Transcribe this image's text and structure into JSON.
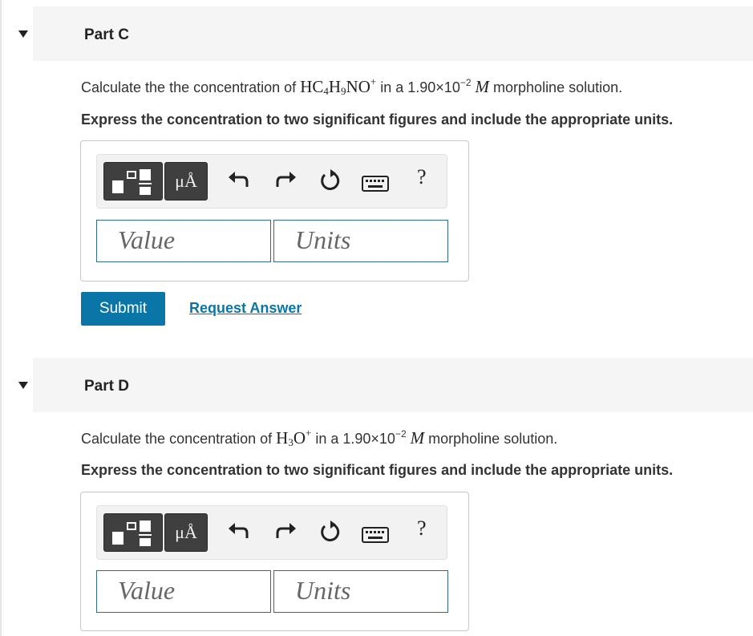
{
  "parts": [
    {
      "title": "Part C",
      "question": {
        "pre": "Calculate the the concentration of ",
        "species_html_parts": {
          "a": "HC",
          "b": "4",
          "c": "H",
          "d": "9",
          "e": "NO",
          "f": "+"
        },
        "mid": " in a 1.90×10",
        "exp": "−2",
        "m": "M",
        "post": " morpholine solution."
      },
      "instruction": "Express the concentration to two significant figures and include the appropriate units.",
      "toolbar": {
        "units_label": "μÅ",
        "help_label": "?"
      },
      "value_placeholder": "Value",
      "units_placeholder": "Units",
      "submit_label": "Submit",
      "request_label": "Request Answer"
    },
    {
      "title": "Part D",
      "question": {
        "pre": "Calculate the concentration of ",
        "species_html_parts": {
          "a": "H",
          "b": "3",
          "e": "O",
          "f": "+"
        },
        "mid": " in a 1.90×10",
        "exp": "−2",
        "m": "M",
        "post": " morpholine solution."
      },
      "instruction": "Express the concentration to two significant figures and include the appropriate units.",
      "toolbar": {
        "units_label": "μÅ",
        "help_label": "?"
      },
      "value_placeholder": "Value",
      "units_placeholder": "Units"
    }
  ],
  "icons": {
    "collapse": "caret-down-icon",
    "templates": "templates-icon",
    "undo": "undo-icon",
    "redo": "redo-icon",
    "reset": "reset-icon",
    "keyboard": "keyboard-icon",
    "help": "help-icon"
  },
  "colors": {
    "accent": "#0a76a8",
    "field_border": "#2f6a8a",
    "header_bg": "#f5f5f5"
  }
}
